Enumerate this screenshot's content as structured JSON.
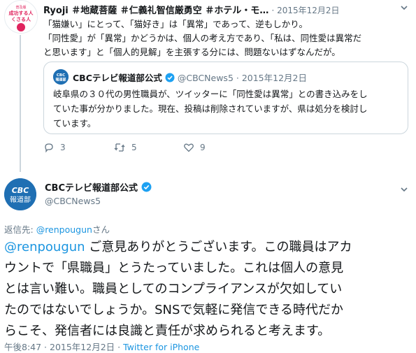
{
  "top_tweet": {
    "avatar_text": [
      "成功する人",
      "くさる人"
    ],
    "display_name": "Ryoji ＃地蔵菩薩 ＃仁義礼智信厳勇空 ＃ホテル・モ…",
    "date": "· 2015年12月2日",
    "text_lines": [
      "「猫嫌い」にとって、「猫好き」は「異常」であって、逆もしかり。",
      "「同性愛」が「異常」かどうかは、個人の考え方であり、「私は、同性愛は異常だ",
      "と思います」と「個人的見解」を主張する分には、問題ないはずなんだが。"
    ],
    "quote": {
      "logo_text": "CBC 報道部",
      "name": "CBCテレビ報道部公式",
      "handle_date": "@CBCNews5 · 2015年12月2日",
      "text_lines": [
        "岐阜県の３０代の男性職員が、ツイッターに「同性愛は異常」との書き込みをし",
        "ていた事が分かりました。現在、投稿は削除されていますが、県は処分を検討し",
        "ています。"
      ]
    },
    "actions": {
      "reply_count": "3",
      "retweet_count": "5",
      "like_count": "9"
    }
  },
  "main_tweet": {
    "avatar_lines": [
      "CBC",
      "報道部"
    ],
    "display_name": "CBCテレビ報道部公式",
    "handle": "@CBCNews5",
    "reply_to_prefix": "返信先: ",
    "reply_to_handle": "@renpougun",
    "reply_to_suffix": "さん",
    "mention": "@renpougun",
    "body_lines": [
      " ご意見ありがとうございます。この職員はアカ",
      "ウントで「県職員」とうたっていました。これは個人の意見",
      "とは言い難い。職員としてのコンプライアンスが欠如してい",
      "たのではないでしょうか。SNSで気軽に発信できる時代だか",
      "らこそ、発信者には良識と責任が求められると考えます。"
    ],
    "timestamp": "午後8:47 · 2015年12月2日 · ",
    "source": "Twitter for iPhone"
  },
  "colors": {
    "link": "#1b95e0",
    "muted": "#657786",
    "brand": "#1f6fb3",
    "verified": "#1da1f2"
  }
}
